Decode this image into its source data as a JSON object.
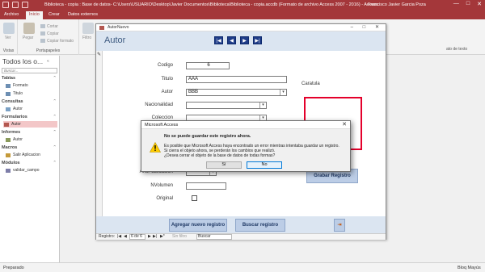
{
  "titlebar": {
    "title": "Biblioteca - copia : Base de datos- C:\\Users\\USUARIO\\Desktop\\Javier Documentos\\Biblioteca\\Biblioteca - copia.accdb (Formato de archivo Access 2007 - 2016)  -  Access",
    "user": "Francisco Javier Garcia Poza",
    "minimize": "—",
    "maximize": "□",
    "close": "✕"
  },
  "tabs": [
    "Archivo",
    "Inicio",
    "Crear",
    "Datos externos"
  ],
  "ribbon": {
    "view_label": "Ver",
    "paste_label": "Pegar",
    "cut_label": "Cortar",
    "copy_label": "Copiar",
    "format_painter_label": "Copiar formato",
    "filter_label": "Filtro",
    "group_views": "Vistas",
    "group_clipboard": "Portapapeles",
    "group_text_format": "ato de texto"
  },
  "nav": {
    "title": "Todos los o...",
    "arrows": "« ",
    "search_placeholder": "Buscar...",
    "sections": [
      {
        "name": "Tablas",
        "items": [
          "Formato",
          "Titulo"
        ]
      },
      {
        "name": "Consultas",
        "items": [
          "Autor"
        ]
      },
      {
        "name": "Formularios",
        "items": [
          "Autor"
        ]
      },
      {
        "name": "Informes",
        "items": [
          "Autor"
        ]
      },
      {
        "name": "Macros",
        "items": [
          "Salir Aplicacion"
        ]
      },
      {
        "name": "Módulos",
        "items": [
          "validar_campo"
        ]
      }
    ]
  },
  "doc": {
    "tab_label": "AutorNuevo",
    "form_title": "Autor",
    "nav_buttons": [
      "|◀",
      "◀",
      "▶",
      "▶|"
    ],
    "fields": {
      "codigo_label": "Codigo",
      "codigo_value": "6",
      "titulo_label": "Titulo",
      "titulo_value": "AAA",
      "autor_label": "Autor",
      "autor_value": "BBB",
      "nacionalidad_label": "Nacionalidad",
      "coleccion_label": "Coleccion",
      "anopublicacion_label": "AnoPublicacion",
      "nvolumen_label": "NVolumen",
      "original_label": "Original"
    },
    "caratula_label": "Caratula",
    "grabar_label": "Grabar Registro",
    "agregar_label": "Agregar nuevo registro",
    "buscar_label": "Buscar registro",
    "record_nav": {
      "label": "Registro:",
      "first": "|◀",
      "prev": "◀",
      "position": "6 de 6",
      "next": "▶",
      "last": "▶|",
      "new": "▶*",
      "filter": "Sin filtro",
      "search": "Buscar"
    }
  },
  "dialog": {
    "title": "Microsoft Access",
    "close": "✕",
    "heading": "No se puede guardar este registro ahora.",
    "body_lines": [
      "Es posible que Microsoft Access haya encontrado un error mientras intentaba guardar un registro.",
      "Si cierra el objeto ahora, se perderán los cambios que realizó.",
      "¿Desea cerrar el objeto de la base de datos de todas formas?"
    ],
    "yes_label": "Sí",
    "no_label": "No"
  },
  "statusbar": {
    "left": "Preparado",
    "right": "Bloq Mayús"
  },
  "colors": {
    "accent": "#a4373a",
    "form_band": "#dbe5f1",
    "nav_button": "#1f3c88",
    "selected_item": "#f3c7c8",
    "caratula_border": "#e4002b"
  }
}
